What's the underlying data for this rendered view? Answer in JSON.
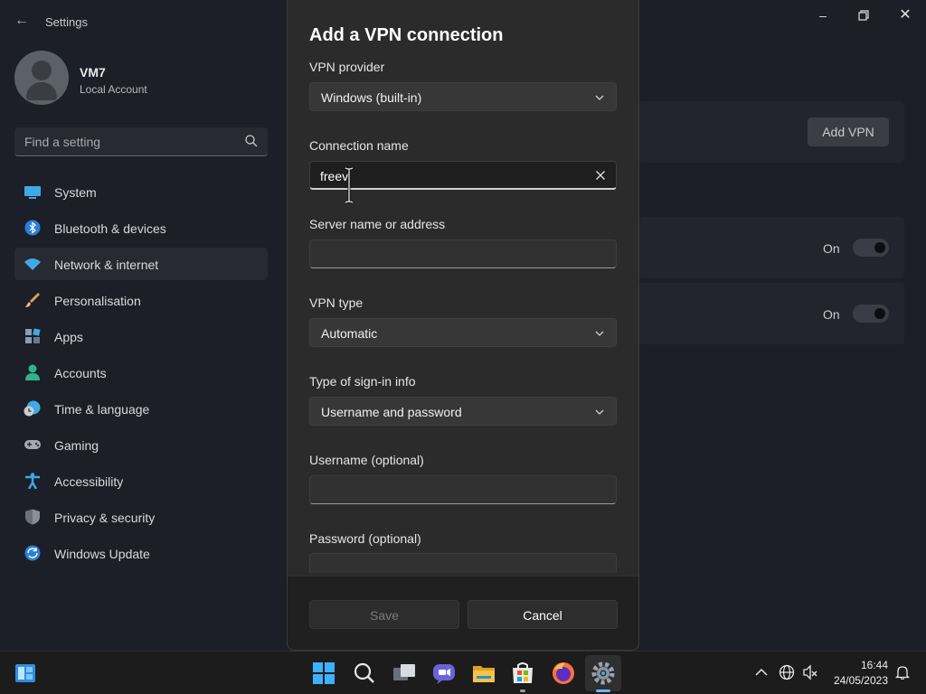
{
  "window": {
    "title": "Settings"
  },
  "profile": {
    "name": "VM7",
    "account_type": "Local Account"
  },
  "search": {
    "placeholder": "Find a setting"
  },
  "sidebar": {
    "items": [
      {
        "label": "System",
        "icon": "system-icon",
        "active": false
      },
      {
        "label": "Bluetooth & devices",
        "icon": "bluetooth-icon",
        "active": false
      },
      {
        "label": "Network & internet",
        "icon": "wifi-icon",
        "active": true
      },
      {
        "label": "Personalisation",
        "icon": "brush-icon",
        "active": false
      },
      {
        "label": "Apps",
        "icon": "apps-icon",
        "active": false
      },
      {
        "label": "Accounts",
        "icon": "person-icon",
        "active": false
      },
      {
        "label": "Time & language",
        "icon": "globe-clock-icon",
        "active": false
      },
      {
        "label": "Gaming",
        "icon": "gamepad-icon",
        "active": false
      },
      {
        "label": "Accessibility",
        "icon": "accessibility-icon",
        "active": false
      },
      {
        "label": "Privacy & security",
        "icon": "shield-icon",
        "active": false
      },
      {
        "label": "Windows Update",
        "icon": "update-icon",
        "active": false
      }
    ]
  },
  "content": {
    "add_vpn_label": "Add VPN",
    "toggles": [
      {
        "state_label": "On"
      },
      {
        "state_label": "On"
      }
    ]
  },
  "dialog": {
    "title": "Add a VPN connection",
    "provider": {
      "label": "VPN provider",
      "value": "Windows (built-in)"
    },
    "connection_name": {
      "label": "Connection name",
      "value": "freev"
    },
    "server": {
      "label": "Server name or address",
      "value": ""
    },
    "vpn_type": {
      "label": "VPN type",
      "value": "Automatic"
    },
    "sign_in_type": {
      "label": "Type of sign-in info",
      "value": "Username and password"
    },
    "username": {
      "label": "Username (optional)",
      "value": ""
    },
    "password": {
      "label": "Password (optional)",
      "value": ""
    },
    "save_label": "Save",
    "cancel_label": "Cancel"
  },
  "taskbar": {
    "apps": [
      "start-icon",
      "search-icon",
      "task-view-icon",
      "teams-chat-icon",
      "file-explorer-icon",
      "microsoft-store-icon",
      "firefox-icon",
      "settings-icon"
    ],
    "clock": {
      "time": "16:44",
      "date": "24/05/2023"
    }
  },
  "colors": {
    "accent": "#4cc2ff",
    "dialog_bg": "#2b2b2b",
    "app_bg": "#1c1f27"
  }
}
